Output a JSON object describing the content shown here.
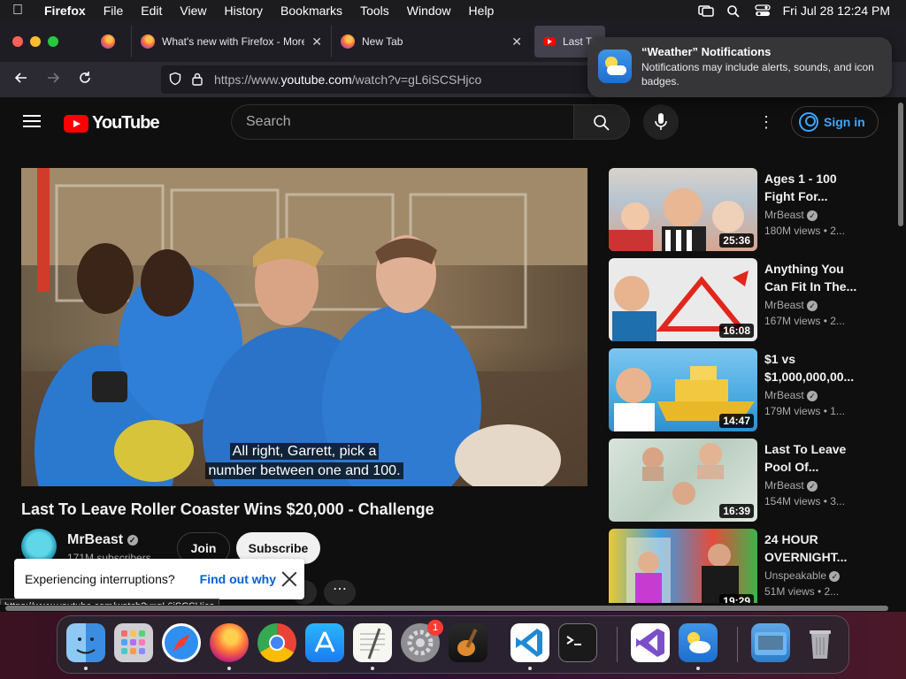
{
  "menubar": {
    "app": "Firefox",
    "items": [
      "File",
      "Edit",
      "View",
      "History",
      "Bookmarks",
      "Tools",
      "Window",
      "Help"
    ],
    "clock": "Fri Jul 28  12:24 PM"
  },
  "tabs": [
    {
      "title": "What's new with Firefox - More"
    },
    {
      "title": "New Tab"
    },
    {
      "title": "Last To"
    }
  ],
  "url": {
    "prefix": "https://www.",
    "domain": "youtube.com",
    "path": "/watch?v=gL6iSCSHjco"
  },
  "youtube": {
    "logo_text": "YouTube",
    "search_placeholder": "Search",
    "sign_in": "Sign in"
  },
  "video": {
    "subtitle_line1": "All right, Garrett, pick a",
    "subtitle_line2": "number between one and 100.",
    "title": "Last To Leave Roller Coaster Wins $20,000 - Challenge",
    "channel": "MrBeast",
    "subscribers": "171M subscribers",
    "join": "Join",
    "subscribe": "Subscribe"
  },
  "toast": {
    "text": "Experiencing interruptions?",
    "link": "Find out why"
  },
  "status_link": "https://www.youtube.com/watch?v=gL6iSCSHjco",
  "recommendations": [
    {
      "title": "Ages 1 - 100 Fight For...",
      "channel": "MrBeast",
      "views": "180M views  • 2...",
      "duration": "25:36"
    },
    {
      "title": "Anything You Can Fit In The...",
      "channel": "MrBeast",
      "views": "167M views  • 2...",
      "duration": "16:08"
    },
    {
      "title": "$1 vs $1,000,000,00...",
      "channel": "MrBeast",
      "views": "179M views  • 1...",
      "duration": "14:47"
    },
    {
      "title": "Last To Leave Pool Of...",
      "channel": "MrBeast",
      "views": "154M views  • 3...",
      "duration": "16:39"
    },
    {
      "title": "24 HOUR OVERNIGHT...",
      "channel": "Unspeakable",
      "views": "51M views  • 2...",
      "duration": "19:29"
    }
  ],
  "notification": {
    "title": "“Weather” Notifications",
    "body": "Notifications may include alerts, sounds, and icon badges."
  },
  "dock": {
    "apps": [
      "finder-icon",
      "launchpad-icon",
      "safari-icon",
      "firefox-icon",
      "chrome-icon",
      "app-store-icon",
      "textedit-icon",
      "system-settings-icon",
      "garageband-icon",
      "vscode-icon",
      "terminal-icon",
      "visual-studio-icon",
      "weather-icon",
      "downloads-folder-icon",
      "trash-icon"
    ],
    "settings_badge": "1"
  }
}
